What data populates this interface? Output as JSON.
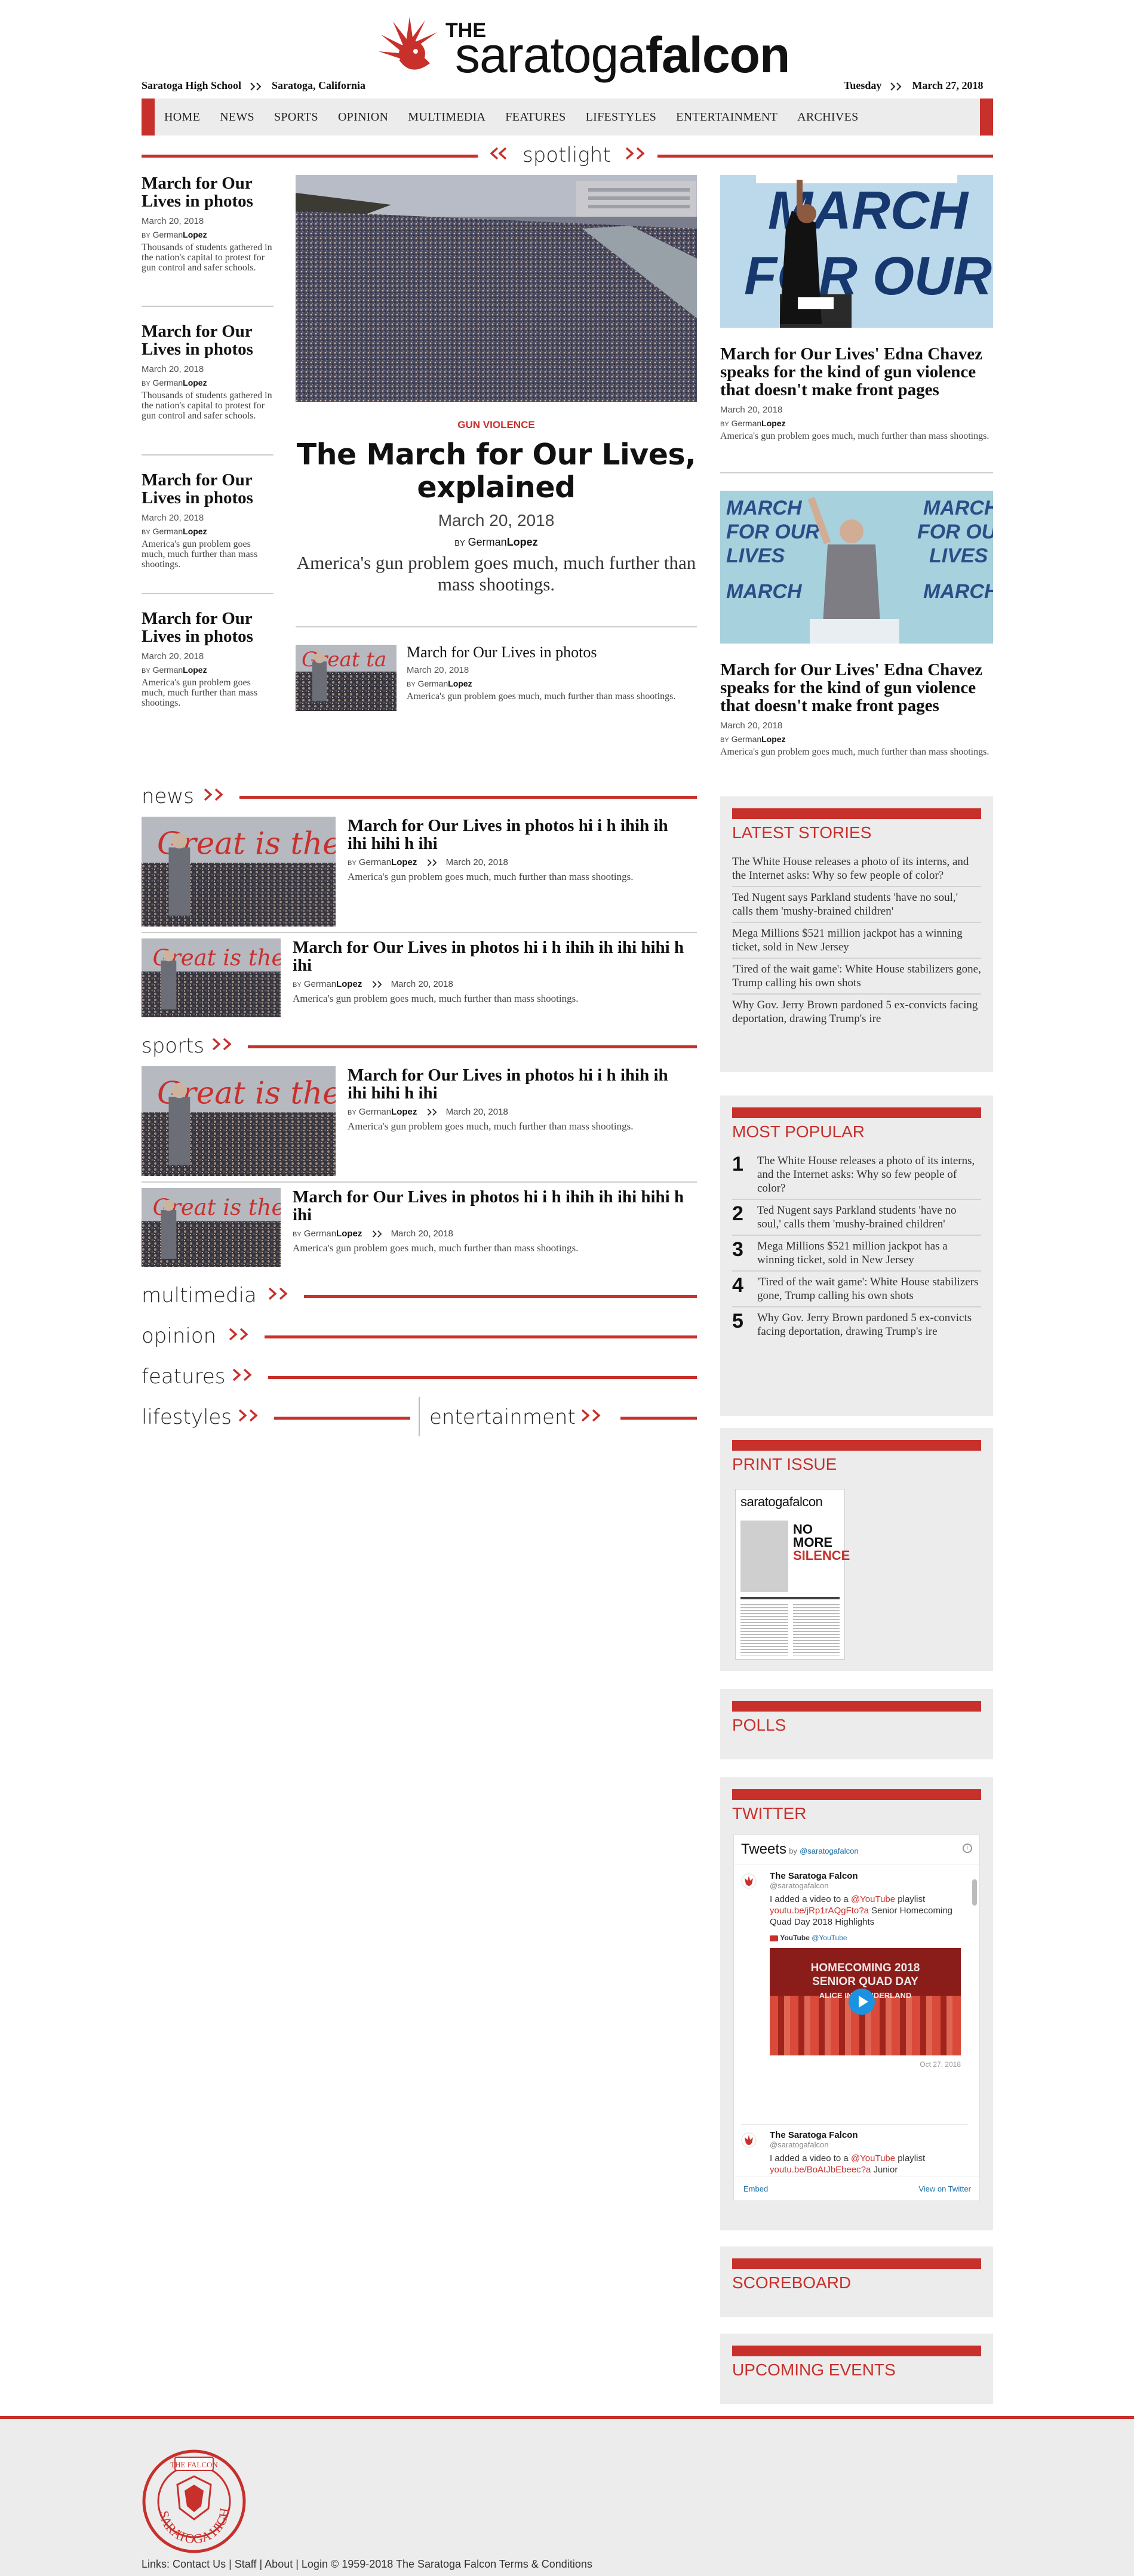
{
  "header": {
    "the": "THE",
    "name_light": "saratoga",
    "name_bold": "falcon",
    "school": "Saratoga High School",
    "location": "Saratoga, California",
    "day": "Tuesday",
    "date": "March 27, 2018"
  },
  "nav": [
    "HOME",
    "NEWS",
    "SPORTS",
    "OPINION",
    "MULTIMEDIA",
    "FEATURES",
    "LIFESTYLES",
    "ENTERTAINMENT",
    "ARCHIVES"
  ],
  "spotlight": {
    "title": "spotlight",
    "left": [
      {
        "title": "March for Our Lives in photos",
        "date": "March 20, 2018",
        "by": "BY",
        "first": "German",
        "last": "Lopez",
        "summary": "Thousands of students gathered in the nation's capital to protest for gun control and safer schools."
      },
      {
        "title": "March for Our Lives in photos",
        "date": "March 20, 2018",
        "by": "BY",
        "first": "German",
        "last": "Lopez",
        "summary": "Thousands of students gathered in the nation's capital to protest for gun control and safer schools."
      },
      {
        "title": "March for Our Lives in photos",
        "date": "March 20, 2018",
        "by": "BY",
        "first": "German",
        "last": "Lopez",
        "summary": "America's gun problem goes much, much further than mass shootings."
      },
      {
        "title": "March for Our Lives in photos",
        "date": "March 20, 2018",
        "by": "BY",
        "first": "German",
        "last": "Lopez",
        "summary": "America's gun problem goes much, much further than mass shootings."
      }
    ],
    "main": {
      "kicker": "GUN VIOLENCE",
      "title": "The March for Our Lives, explained",
      "date": "March 20, 2018",
      "by": "BY",
      "first": "German",
      "last": "Lopez",
      "summary": "America's gun problem goes much, much further than mass shootings."
    },
    "sub": {
      "title": "March for Our Lives in photos",
      "date": "March 20, 2018",
      "by": "BY",
      "first": "German",
      "last": "Lopez",
      "summary": "America's gun problem goes much, much further than mass shootings."
    },
    "right": [
      {
        "title": "March for Our Lives' Edna Chavez speaks for the kind of gun violence that doesn't make front pages",
        "date": "March 20, 2018",
        "by": "BY",
        "first": "German",
        "last": "Lopez",
        "summary": "America's gun problem goes much, much further than mass shootings."
      },
      {
        "title": "March for Our Lives' Edna Chavez speaks for the kind of gun violence that doesn't make front pages",
        "date": "March 20, 2018",
        "by": "BY",
        "first": "German",
        "last": "Lopez",
        "summary": "America's gun problem goes much, much further than mass shootings."
      }
    ]
  },
  "sections": {
    "news": "news",
    "sports": "sports",
    "multimedia": "multimedia",
    "opinion": "opinion",
    "features": "features",
    "lifestyles": "lifestyles",
    "entertainment": "entertainment"
  },
  "news_items": [
    {
      "title": "March for Our Lives in photos hi i h ihih ih ihi hihi h ihi",
      "by": "BY",
      "first": "German",
      "last": "Lopez",
      "date": "March 20, 2018",
      "summary": "America's gun problem goes much, much further than mass shootings."
    },
    {
      "title": "March for Our Lives in photos hi i h ihih ih ihi hihi h ihi",
      "by": "BY",
      "first": "German",
      "last": "Lopez",
      "date": "March 20, 2018",
      "summary": "America's gun problem goes much, much further than mass shootings."
    }
  ],
  "sports_items": [
    {
      "title": "March for Our Lives in photos hi i h ihih ih ihi hihi h ihi",
      "by": "BY",
      "first": "German",
      "last": "Lopez",
      "date": "March 20, 2018",
      "summary": "America's gun problem goes much, much further than mass shootings."
    },
    {
      "title": "March for Our Lives in photos hi i h ihih ih ihi hihi h ihi",
      "by": "BY",
      "first": "German",
      "last": "Lopez",
      "date": "March 20, 2018",
      "summary": "America's gun problem goes much, much further than mass shootings."
    }
  ],
  "photo_text": {
    "sign": "Great is the Falcon"
  },
  "latest": {
    "title": "LATEST STORIES",
    "items": [
      "The White House releases a photo of its interns, and the Internet asks: Why so few people of color?",
      "Ted Nugent says Parkland students 'have no soul,' calls them 'mushy-brained children'",
      "Mega Millions $521 million jackpot has a winning ticket, sold in New Jersey",
      "'Tired of the wait game': White House stabilizers gone, Trump calling his own shots",
      "Why Gov. Jerry Brown pardoned 5 ex-convicts facing deportation, drawing Trump's ire"
    ]
  },
  "popular": {
    "title": "MOST POPULAR",
    "items": [
      {
        "n": "1",
        "text": "The White House releases a photo of its interns, and the Internet asks: Why so few people of color?"
      },
      {
        "n": "2",
        "text": "Ted Nugent says Parkland students 'have no soul,' calls them 'mushy-brained children'"
      },
      {
        "n": "3",
        "text": "Mega Millions $521 million jackpot has a winning ticket, sold in New Jersey"
      },
      {
        "n": "4",
        "text": "'Tired of the wait game': White House stabilizers gone, Trump calling his own shots"
      },
      {
        "n": "5",
        "text": "Why Gov. Jerry Brown pardoned 5 ex-convicts facing deportation, drawing Trump's ire"
      }
    ]
  },
  "print": {
    "title": "PRINT ISSUE",
    "cover_name": "saratogafalcon",
    "cover_headline_1": "NO",
    "cover_headline_2": "MORE",
    "cover_headline_3": "SILENCE"
  },
  "polls": {
    "title": "POLLS"
  },
  "twitter": {
    "title": "TWITTER",
    "tweets_label": "Tweets",
    "by": "by",
    "handle": "@saratogafalcon",
    "tweet1": {
      "name": "The Saratoga Falcon",
      "handle": "@saratogafalcon",
      "pre": "I added a video to a ",
      "mention": "@YouTube",
      "post": " playlist",
      "link": "youtu.be/jRp1rAQgFto?a",
      "rest": " Senior Homecoming Quad Day 2018 Highlights",
      "card_source": "YouTube",
      "card_handle": "@YouTube",
      "video_line1": "HOMECOMING 2018",
      "video_line2": "SENIOR QUAD DAY",
      "video_line3": "ALICE IN WONDERLAND",
      "time": "Oct 27, 2018"
    },
    "tweet2": {
      "name": "The Saratoga Falcon",
      "handle": "@saratogafalcon",
      "pre": "I added a video to a ",
      "mention": "@YouTube",
      "post": " playlist",
      "link": "youtu.be/BoAtJbEbeec?a",
      "rest": " Junior"
    },
    "embed": "Embed",
    "view": "View on Twitter"
  },
  "scoreboard": {
    "title": "SCOREBOARD"
  },
  "events": {
    "title": "UPCOMING EVENTS"
  },
  "footer": {
    "seal_top": "THE FALCON",
    "seal_bottom": "SARATOGA HIGH SCHOOL",
    "links_prefix": "Links:",
    "contact": "Contact Us",
    "staff": "Staff",
    "about": "About",
    "login": "Login",
    "copyright": "© 1959-2018 The Saratoga Falcon",
    "terms": "Terms & Conditions"
  },
  "colors": {
    "accent": "#c8302c",
    "widget_bg": "#ececec",
    "footer_bg": "#ececec"
  }
}
